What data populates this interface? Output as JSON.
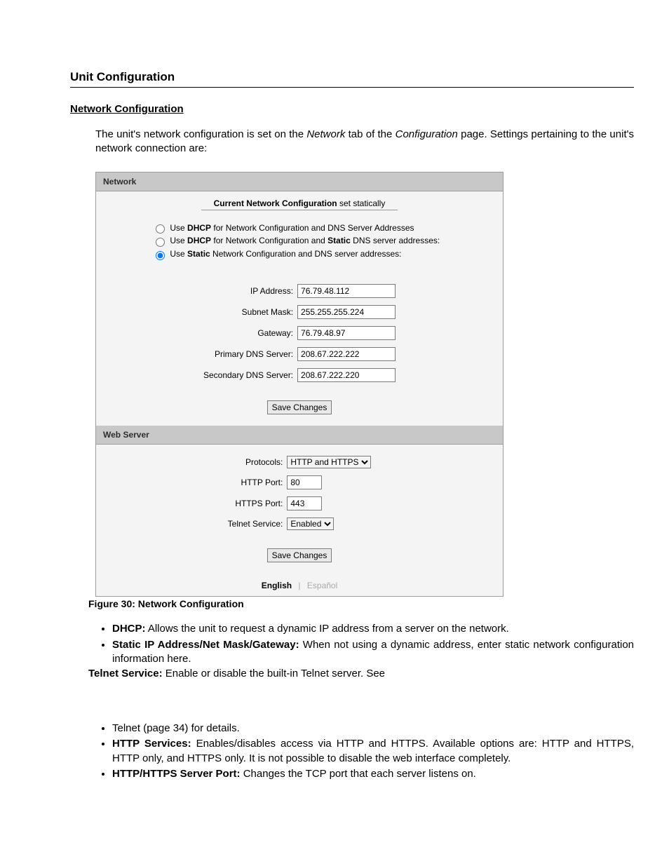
{
  "headings": {
    "unit_config": "Unit Configuration",
    "network_config": "Network Configuration"
  },
  "intro": {
    "pre": "The unit's network configuration is set on the ",
    "i1": "Network",
    "mid": " tab of the ",
    "i2": "Configuration",
    "post": " page.  Settings pertaining to the unit's network connection are:"
  },
  "panel1": {
    "title": "Network",
    "current_b": "Current Network Configuration",
    "current_rest": " set statically",
    "radios": {
      "r1_pre": "Use ",
      "r1_b": "DHCP",
      "r1_post": " for Network Configuration and DNS Server Addresses",
      "r2_pre": "Use ",
      "r2_b1": "DHCP",
      "r2_mid": " for Network Configuration and ",
      "r2_b2": "Static",
      "r2_post": " DNS server addresses:",
      "r3_pre": "Use ",
      "r3_b": "Static",
      "r3_post": " Network Configuration and DNS server addresses:"
    },
    "fields": {
      "ip_label": "IP Address:",
      "ip_value": "76.79.48.112",
      "mask_label": "Subnet Mask:",
      "mask_value": "255.255.255.224",
      "gw_label": "Gateway:",
      "gw_value": "76.79.48.97",
      "dns1_label": "Primary DNS Server:",
      "dns1_value": "208.67.222.222",
      "dns2_label": "Secondary DNS Server:",
      "dns2_value": "208.67.222.220"
    },
    "save": "Save Changes"
  },
  "panel2": {
    "title": "Web Server",
    "proto_label": "Protocols:",
    "proto_value": "HTTP and HTTPS",
    "http_label": "HTTP Port:",
    "http_value": "80",
    "https_label": "HTTPS Port:",
    "https_value": "443",
    "telnet_label": "Telnet Service:",
    "telnet_value": "Enabled",
    "save": "Save Changes"
  },
  "lang": {
    "english": "English",
    "spanish": "Español"
  },
  "caption": "Figure 30: Network Configuration",
  "descA": {
    "li1_b": "DHCP:",
    "li1": " Allows the unit to request a dynamic IP address from a server on the network.",
    "li2_b": "Static IP Address/Net Mask/Gateway:",
    "li2": " When not using a dynamic address, enter static network configuration information here.",
    "telnet_b": "Telnet Service:",
    "telnet": " Enable or disable the built-in Telnet server.  See"
  },
  "descB": {
    "li1": "Telnet (page 34) for details.",
    "li2_b": "HTTP Services:",
    "li2": " Enables/disables access via HTTP and HTTPS.  Available options are: HTTP and HTTPS, HTTP only, and HTTPS only.  It is not possible to disable the web interface completely.",
    "li3_b": "HTTP/HTTPS Server Port:",
    "li3": " Changes the TCP port that each server listens on."
  }
}
